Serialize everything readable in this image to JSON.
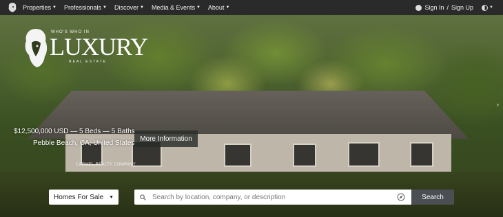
{
  "nav": {
    "items": [
      {
        "label": "Properties"
      },
      {
        "label": "Professionals"
      },
      {
        "label": "Discover"
      },
      {
        "label": "Media & Events"
      },
      {
        "label": "About"
      }
    ],
    "sign_in": "Sign In",
    "separator": "/",
    "sign_up": "Sign Up",
    "icons": {
      "logo": "lion-logo-icon",
      "user": "user-icon",
      "theme": "theme-toggle-icon",
      "caret": "caret-down-icon"
    }
  },
  "brand": {
    "tagline_small": "WHO'S WHO IN",
    "name": "LUXURY",
    "subtitle": "REAL ESTATE"
  },
  "listing": {
    "price_line": "$12,500,000 USD — 5 Beds — 5 Baths",
    "location": "Pebble Beach, CA, United States",
    "more_label": "More Information",
    "credit": "CARMEL REALTY COMPANY"
  },
  "search": {
    "type_selected": "Homes For Sale",
    "placeholder": "Search by location, company, or description",
    "value": "",
    "button_label": "Search",
    "icons": {
      "search": "search-icon",
      "locate": "compass-icon",
      "dropdown": "caret-down-icon",
      "slider_next": "chevron-right-icon"
    }
  },
  "colors": {
    "nav_bg": "#2a2a2a",
    "search_button": "#4b4f53",
    "more_button": "#282d28"
  }
}
